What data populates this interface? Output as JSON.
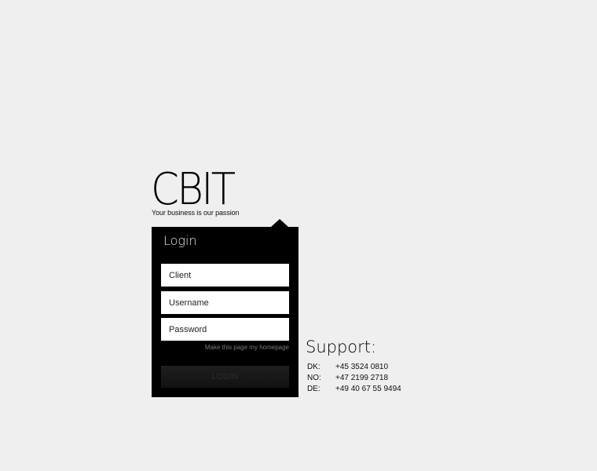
{
  "brand": {
    "name": "CBIT",
    "tagline": "Your business is our passion"
  },
  "login": {
    "title": "Login",
    "fields": {
      "client_placeholder": "Client",
      "username_placeholder": "Username",
      "password_placeholder": "Password"
    },
    "homepage_link": "Make this page my homepage",
    "button_label": "LOGIN"
  },
  "support": {
    "title": "Support:",
    "phones": [
      {
        "country": "DK:",
        "number": "+45 3524 0810"
      },
      {
        "country": "NO:",
        "number": "+47 2199 2718"
      },
      {
        "country": "DE:",
        "number": "+49 40 67 55 9494"
      }
    ]
  },
  "colors": {
    "background": "#efefef",
    "panel": "#000000",
    "field": "#ffffff"
  }
}
